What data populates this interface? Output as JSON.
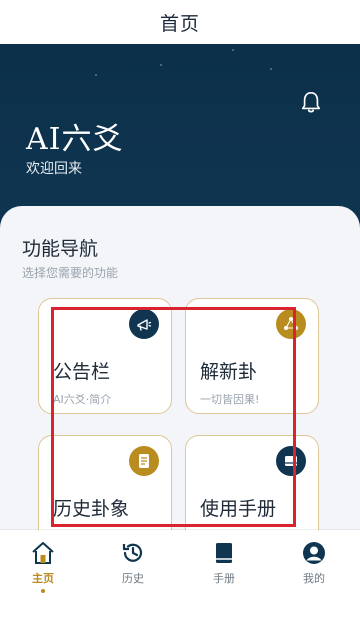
{
  "header": {
    "title": "首页"
  },
  "hero": {
    "title": "AI六爻",
    "subtitle": "欢迎回来"
  },
  "section": {
    "title": "功能导航",
    "subtitle": "选择您需要的功能"
  },
  "cards": [
    {
      "title": "公告栏",
      "subtitle": "AI六爻·简介",
      "icon": "megaphone-icon"
    },
    {
      "title": "解新卦",
      "subtitle": "一切皆因果!",
      "icon": "share-nodes-icon"
    },
    {
      "title": "历史卦象",
      "subtitle": "",
      "icon": "document-icon"
    },
    {
      "title": "使用手册",
      "subtitle": "",
      "icon": "book-icon"
    }
  ],
  "tabs": [
    {
      "label": "主页",
      "icon": "home-icon",
      "active": true
    },
    {
      "label": "历史",
      "icon": "history-icon",
      "active": false
    },
    {
      "label": "手册",
      "icon": "book-icon",
      "active": false
    },
    {
      "label": "我的",
      "icon": "profile-icon",
      "active": false
    }
  ],
  "colors": {
    "primary": "#0f3551",
    "accent": "#b98c1f",
    "highlight": "#d9232f"
  }
}
